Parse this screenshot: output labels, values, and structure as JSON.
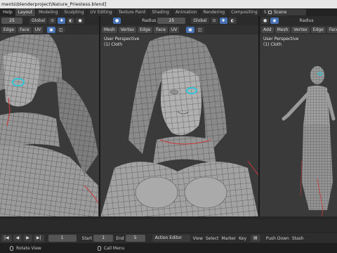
{
  "window": {
    "title": "ments\\blenderproject\\Nature_Priestess.blend]"
  },
  "topbar": {
    "menu": [
      "Help"
    ],
    "workspaces": [
      "Layout",
      "Modeling",
      "Sculpting",
      "UV Editing",
      "Texture Paint",
      "Shading",
      "Animation",
      "Rendering",
      "Compositing",
      "Scripting"
    ],
    "active_workspace": "Layout",
    "scene": "Scene"
  },
  "viewports": [
    {
      "head1": {
        "radius_value": "25",
        "orientation": "Global"
      },
      "head2": {
        "items": [
          "Edge",
          "Face",
          "UV"
        ]
      },
      "info": [
        "",
        ""
      ]
    },
    {
      "head1": {
        "radius_label": "Radius",
        "radius_value": "25",
        "orientation": "Global"
      },
      "head2": {
        "items": [
          "Mesh",
          "Vertex",
          "Edge",
          "Face",
          "UV"
        ]
      },
      "info": [
        "User Perspective",
        "(1) Cloth"
      ]
    },
    {
      "head1": {
        "radius_label": "Radius"
      },
      "head2": {
        "items": [
          "Add",
          "Mesh",
          "Vertex",
          "Edge",
          "Face"
        ]
      },
      "info": [
        "User Perspective",
        "(1) Cloth"
      ]
    }
  ],
  "timeline": {
    "current_frame": "1",
    "start_label": "Start",
    "start_value": "1",
    "end_label": "End",
    "end_value": "5",
    "editor_type": "Action Editor",
    "menus": [
      "View",
      "Select",
      "Marker",
      "Key"
    ],
    "push_down": "Push Down",
    "stash": "Stash"
  },
  "status": {
    "left": "Rotate View",
    "middle": "Call Menu"
  },
  "colors": {
    "accent": "#4772b3",
    "selection_cyan": "#2fc7d8",
    "seam_red": "#c83a3a"
  }
}
